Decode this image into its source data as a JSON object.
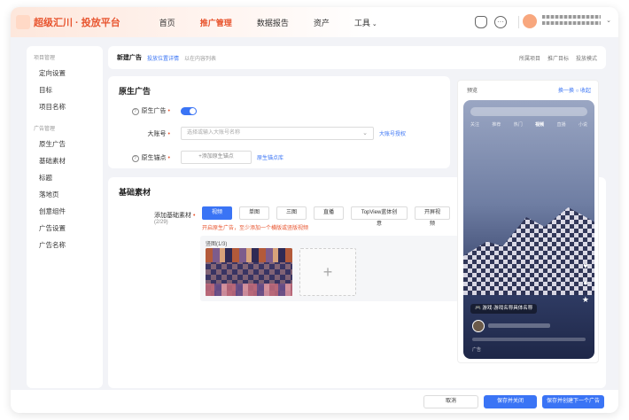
{
  "header": {
    "brand": "超级汇川 · 投放平台",
    "nav": [
      {
        "label": "首页"
      },
      {
        "label": "推广管理",
        "active": true
      },
      {
        "label": "数据报告"
      },
      {
        "label": "资产"
      },
      {
        "label": "工具"
      }
    ],
    "caret": "⌄",
    "user_caret": "⌄"
  },
  "sidebar": {
    "groups": [
      {
        "title": "项目管理",
        "items": [
          "定向设置",
          "目标",
          "项目名称"
        ]
      },
      {
        "title": "广告管理",
        "items": [
          "原生广告",
          "基础素材",
          "标题",
          "落地页",
          "创意组件",
          "广告设置",
          "广告名称"
        ]
      }
    ]
  },
  "breadcrumb": {
    "main": "新建广告",
    "link": "投放位置详情",
    "gray": "以在内容列表",
    "right": [
      "所属项目",
      "推广目标",
      "投放模式"
    ]
  },
  "native": {
    "title": "原生广告",
    "rows": {
      "native_ad": {
        "label": "原生广告"
      },
      "account": {
        "label": "大账号",
        "placeholder": "选择或输入大账号名称",
        "link": "大账号授权"
      },
      "anchor": {
        "label": "原生锚点",
        "value": "+添加原生锚点",
        "link": "原生锚点库"
      }
    }
  },
  "material": {
    "title": "基础素材",
    "label": "添加基础素材",
    "count": "(2/29)",
    "tabs": [
      "视频",
      "单图",
      "三图",
      "直播",
      "TopView蓝体创意",
      "开屏视频"
    ],
    "active_tab": "视频",
    "warning": "开启原生广告，至少添加一个横版或竖版视频",
    "upload_head": "竖图(1/3)",
    "add_symbol": "+"
  },
  "preview": {
    "title": "预览",
    "links": "换一换 ○  收起",
    "tabs": [
      "关注",
      "推荐",
      "热门",
      "视频",
      "直播",
      "小说"
    ],
    "active_tab": "视频",
    "game_badge": "🎮 游戏·游戏名称具体名称",
    "bottom_text": "广告"
  },
  "footer": {
    "cancel": "取消",
    "save_close": "保存并关闭",
    "save_next": "保存并创建下一个广告"
  },
  "colors": {
    "accent": "#3a74f5",
    "brand": "#e8542e",
    "warning": "#e8542e"
  }
}
